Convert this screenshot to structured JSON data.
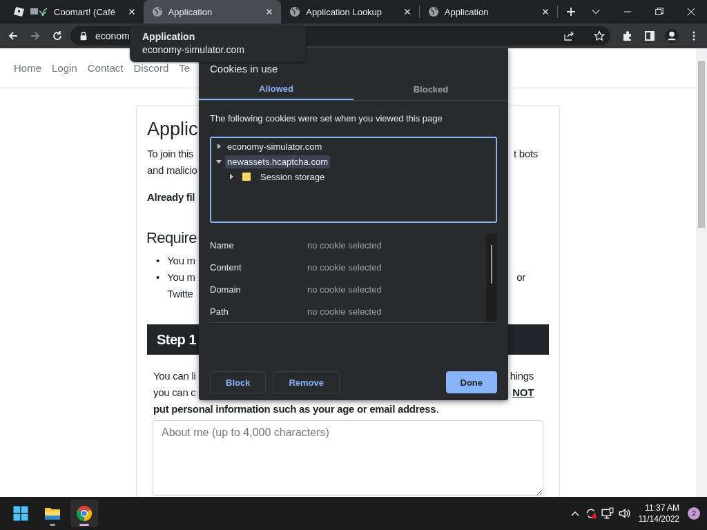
{
  "browser": {
    "tabs": [
      {
        "title": "Coomart! (Café",
        "kind": "cube",
        "title_icons": true,
        "selected": false
      },
      {
        "title": "Application",
        "kind": "globe",
        "title_icons": false,
        "selected": true
      },
      {
        "title": "Application Lookup",
        "kind": "globe",
        "title_icons": false,
        "selected": false
      },
      {
        "title": "Application",
        "kind": "globe",
        "title_icons": false,
        "selected": false
      }
    ],
    "address": "econom",
    "tooltip": {
      "title": "Application",
      "url": "economy-simulator.com"
    }
  },
  "page": {
    "nav": [
      "Home",
      "Login",
      "Contact",
      "Discord",
      "Te"
    ],
    "heading": "Applic",
    "intro_lines": [
      {
        "left": "To join this",
        "right": "t bots"
      },
      {
        "left": "and malicio"
      }
    ],
    "already": "Already fil",
    "requirements_heading": "Require",
    "requirements": [
      {
        "marker": "•",
        "lines": [
          {
            "left": "You m"
          }
        ]
      },
      {
        "marker": "•",
        "lines": [
          {
            "left": "You m",
            "right": "or"
          },
          {
            "left": "Twitte"
          }
        ]
      }
    ],
    "step_title": "Step 1",
    "step_lines": [
      {
        "left": "You can li",
        "right": "hings",
        "right_bold": false
      },
      {
        "left": "you can c",
        "right": "NOT",
        "right_bold": true
      },
      {
        "left": "**put personal information such as your age or email address**."
      }
    ],
    "about_placeholder": "About me (up to 4,000 characters)"
  },
  "dialog": {
    "title": "Cookies in use",
    "tabs": [
      {
        "label": "Allowed",
        "selected": true
      },
      {
        "label": "Blocked",
        "selected": false
      }
    ],
    "description": "The following cookies were set when you viewed this page",
    "tree": [
      {
        "label": "economy-simulator.com",
        "kind": "site",
        "expanded": false,
        "selected": false
      },
      {
        "label": "newassets.hcaptcha.com",
        "kind": "site",
        "expanded": true,
        "selected": true,
        "children": [
          {
            "label": "Session storage",
            "kind": "folder",
            "expanded": false,
            "selected": false
          }
        ]
      }
    ],
    "details": [
      {
        "label": "Name",
        "value": "no cookie selected"
      },
      {
        "label": "Content",
        "value": "no cookie selected"
      },
      {
        "label": "Domain",
        "value": "no cookie selected"
      },
      {
        "label": "Path",
        "value": "no cookie selected"
      }
    ],
    "buttons": [
      {
        "label": "Block",
        "kind": "secondary"
      },
      {
        "label": "Remove",
        "kind": "secondary"
      },
      {
        "label": "Done",
        "kind": "primary"
      }
    ]
  },
  "taskbar": {
    "apps": [
      {
        "kind": "explorer",
        "active": false
      },
      {
        "kind": "chrome",
        "active": true
      }
    ],
    "time": "11:37 AM",
    "date": "11/14/2022",
    "notifications": "2"
  }
}
